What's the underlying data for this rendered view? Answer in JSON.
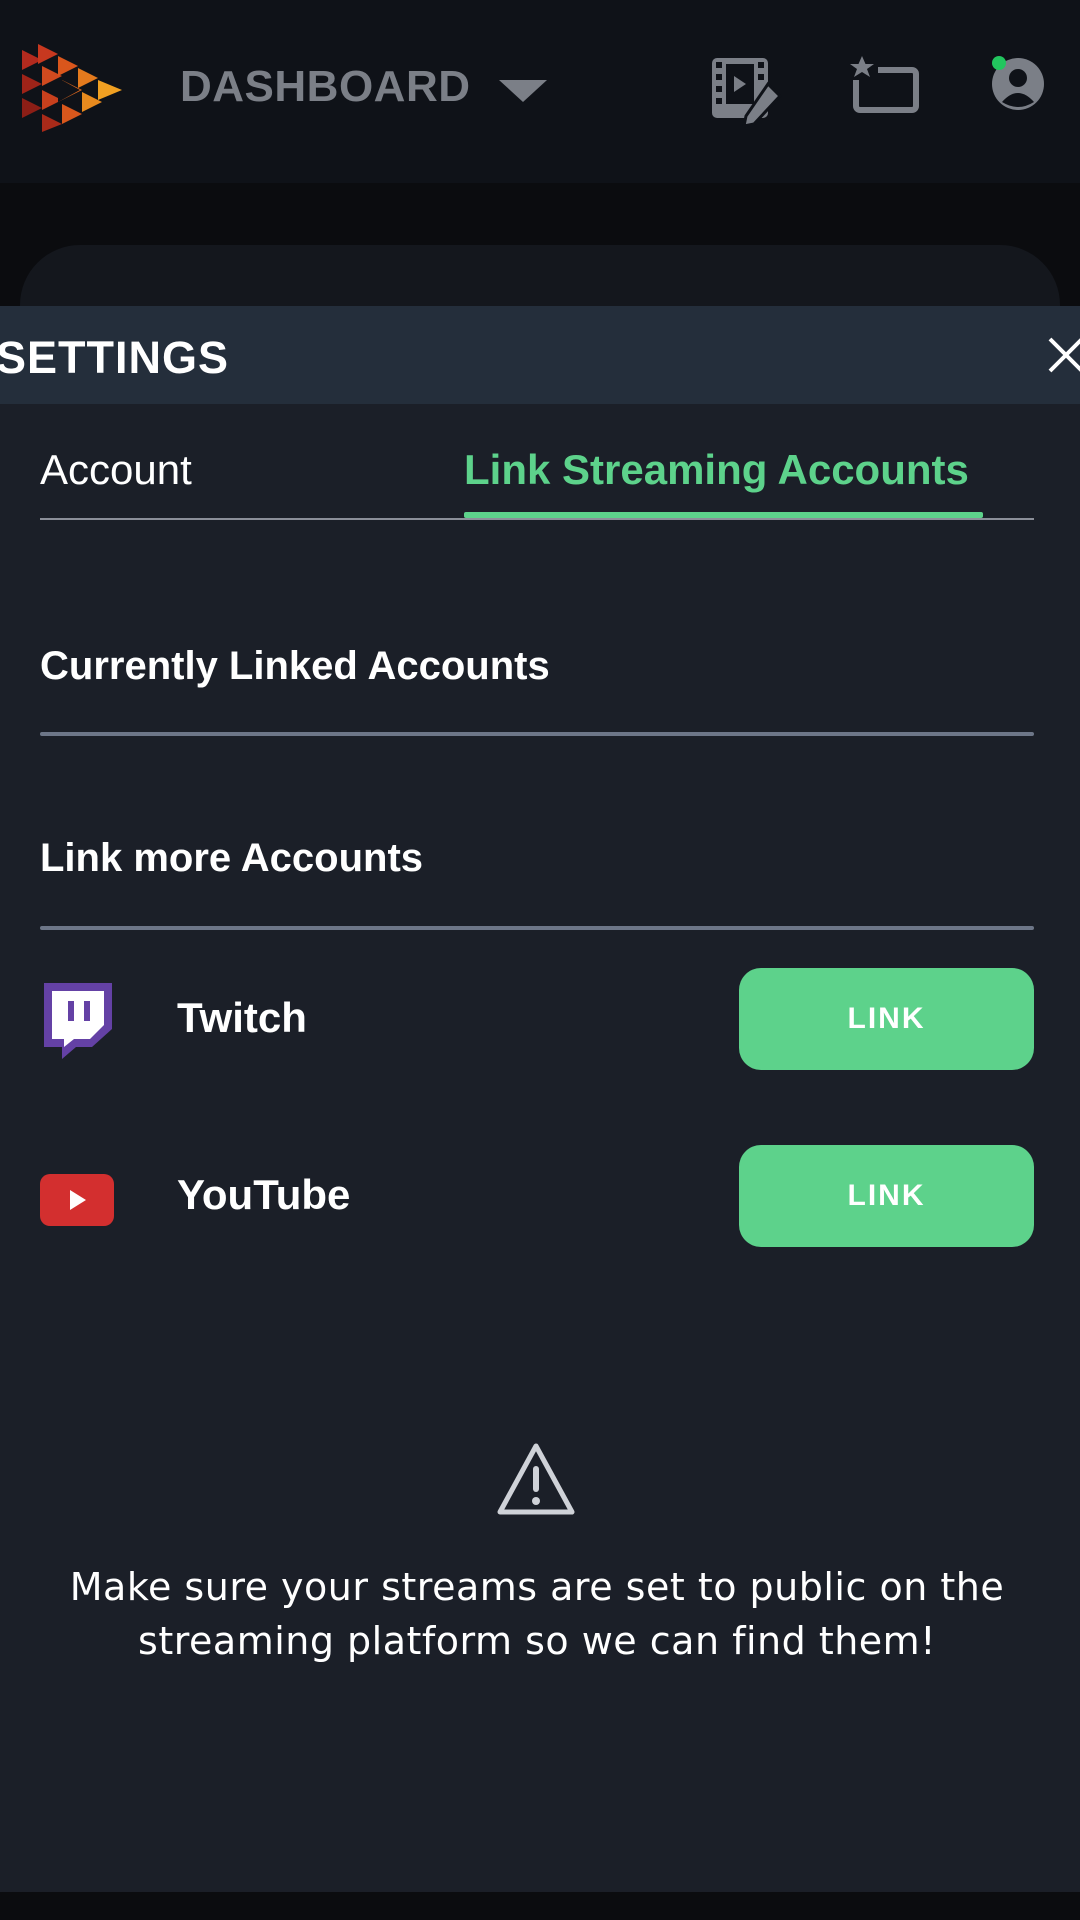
{
  "header": {
    "title": "DASHBOARD",
    "icons": [
      "logo-icon",
      "video-edit-icon",
      "favorites-icon",
      "user-icon"
    ],
    "online_status_color": "#22c55e"
  },
  "settings": {
    "title": "SETTINGS",
    "tabs": [
      {
        "label": "Account",
        "active": false
      },
      {
        "label": "Link Streaming Accounts",
        "active": true
      }
    ],
    "sections": {
      "linked_title": "Currently Linked Accounts",
      "more_title": "Link more Accounts"
    },
    "platforms": [
      {
        "name": "Twitch",
        "button": "LINK",
        "icon": "twitch-icon",
        "color": "#6441a5"
      },
      {
        "name": "YouTube",
        "button": "LINK",
        "icon": "youtube-icon",
        "color": "#d32f2f"
      }
    ],
    "notice": "Make sure your streams are set to public on the streaming platform so we can find them!"
  },
  "colors": {
    "accent": "#5dd28b",
    "panel": "#1b1f28",
    "panel_header": "#242e3b",
    "topbar": "#0f1218"
  }
}
